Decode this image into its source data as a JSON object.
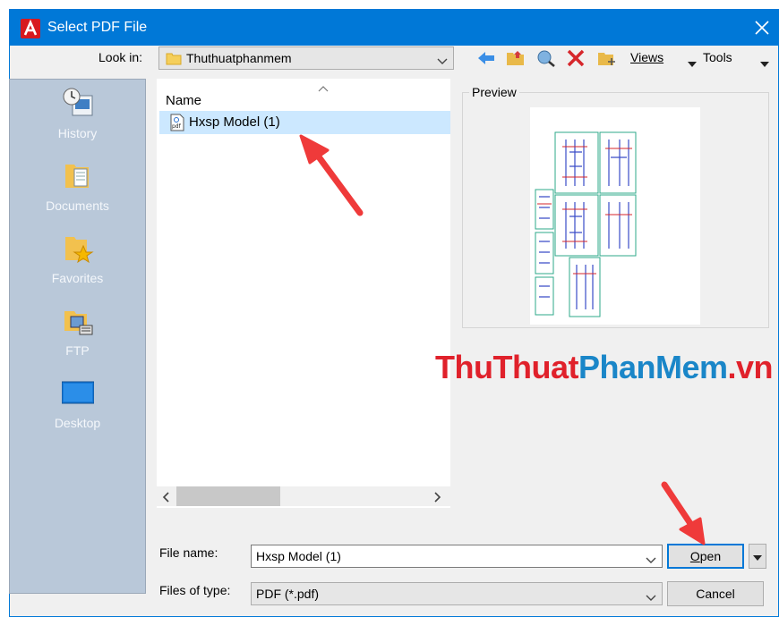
{
  "window": {
    "title": "Select PDF File"
  },
  "lookin": {
    "label": "Look in:",
    "value": "Thuthuatphanmem"
  },
  "toolbar": {
    "views_label": "Views",
    "tools_label": "Tools"
  },
  "places": [
    {
      "label": "History",
      "icon": "history-icon"
    },
    {
      "label": "Documents",
      "icon": "documents-icon"
    },
    {
      "label": "Favorites",
      "icon": "favorites-icon"
    },
    {
      "label": "FTP",
      "icon": "ftp-icon"
    },
    {
      "label": "Desktop",
      "icon": "desktop-icon"
    }
  ],
  "filelist": {
    "column_name": "Name",
    "files": [
      {
        "name": "Hxsp Model (1)",
        "icon": "pdf-file-icon",
        "selected": true
      }
    ]
  },
  "preview": {
    "label": "Preview"
  },
  "watermark": {
    "part1": "ThuThuat",
    "part2": "PhanMem",
    "part3": ".vn"
  },
  "filename": {
    "label": "File name:",
    "value": "Hxsp Model (1)"
  },
  "filetype": {
    "label": "Files of type:",
    "value": "PDF (*.pdf)"
  },
  "buttons": {
    "open_prefix": "",
    "open_mnemonic": "O",
    "open_rest": "pen",
    "cancel": "Cancel"
  },
  "colors": {
    "titlebar": "#0078d7",
    "selection": "#cce8ff",
    "places_panel": "#b9c8d9",
    "annotation_arrow": "#ef3a3a"
  }
}
